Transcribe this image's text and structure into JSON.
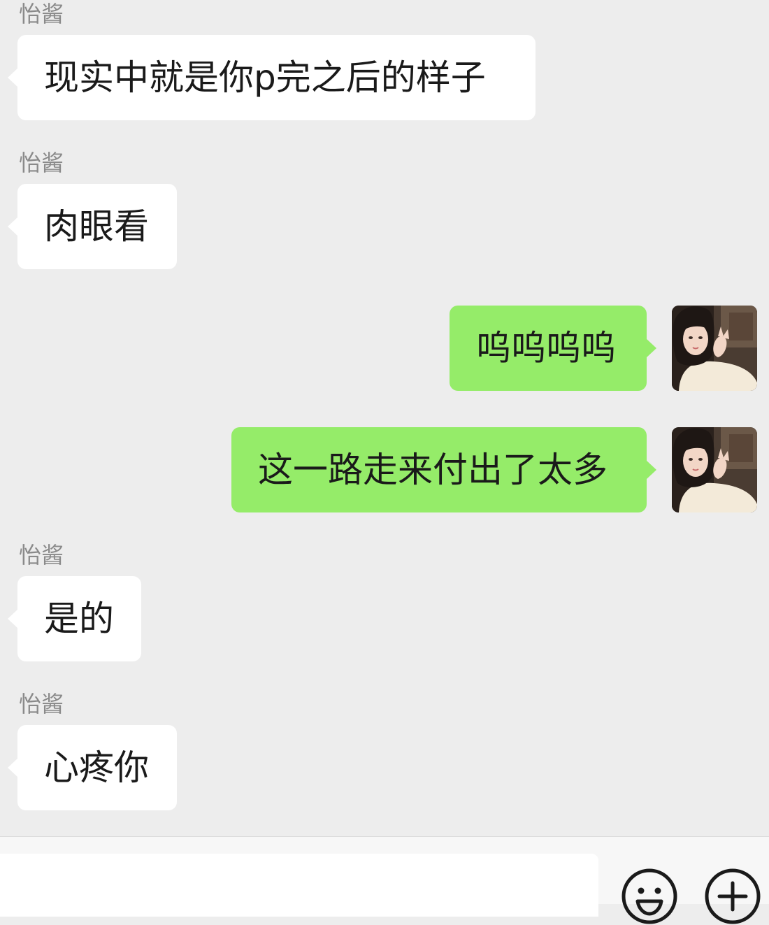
{
  "conversation": {
    "messages": [
      {
        "direction": "incoming",
        "sender": "怡酱",
        "text": "现实中就是你p完之后的样子"
      },
      {
        "direction": "incoming",
        "sender": "怡酱",
        "text": "肉眼看"
      },
      {
        "direction": "outgoing",
        "text": "呜呜呜呜",
        "avatar": "user-avatar-photo"
      },
      {
        "direction": "outgoing",
        "text": "这一路走来付出了太多",
        "avatar": "user-avatar-photo"
      },
      {
        "direction": "incoming",
        "sender": "怡酱",
        "text": "是的"
      },
      {
        "direction": "incoming",
        "sender": "怡酱",
        "text": "心疼你"
      }
    ]
  },
  "input_bar": {
    "value": "",
    "emoji_icon": "emoji-icon",
    "plus_icon": "plus-icon"
  },
  "colors": {
    "background": "#ededed",
    "incoming_bubble": "#ffffff",
    "outgoing_bubble": "#95ec69",
    "sender_name": "#8a8a8a",
    "message_text": "#1a1a1a"
  }
}
